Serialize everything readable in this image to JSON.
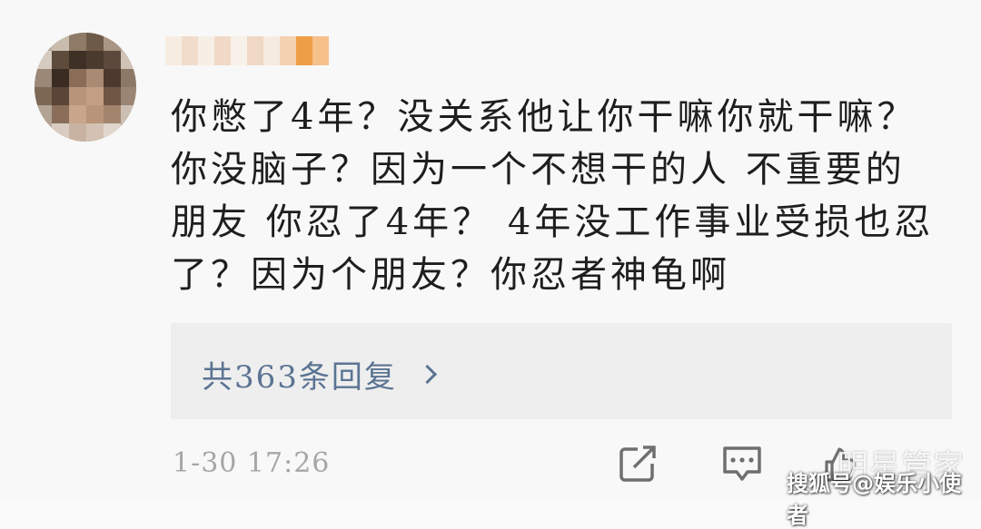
{
  "comment": {
    "lines": [
      "你憋了4年？没关系他让你干嘛你就干嘛？",
      "你没脑子？因为一个不想干的人 不重要的",
      "朋友 你忍了4年？ 4年没工作事业受损也忍",
      "了？因为个朋友？你忍者神龟啊"
    ]
  },
  "replies": {
    "label": "共363条回复"
  },
  "meta": {
    "timestamp": "1-30 17:26"
  },
  "watermark": {
    "top": "明星管家",
    "bottom": "搜狐号@娱乐小使者"
  },
  "colors": {
    "text": "#1e1e1e",
    "link": "#5b7493",
    "muted": "#a6a6a6",
    "reply_bg": "#eeeeee"
  },
  "icons": {
    "share": "share-icon",
    "comment": "comment-icon",
    "like": "like-icon"
  }
}
